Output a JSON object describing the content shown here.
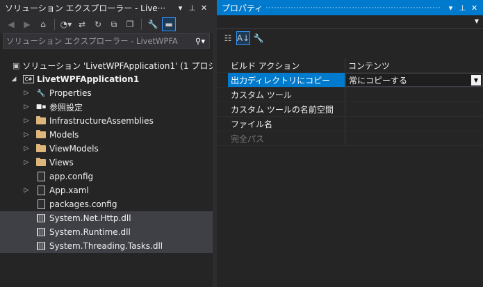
{
  "solution_explorer": {
    "title": "ソリューション エクスプローラー - Live···",
    "search_placeholder": "ソリューション エクスプローラー - LivetWPFA",
    "tree": [
      {
        "label": "ソリューション 'LivetWPFApplication1' (1 プロジ",
        "icon": "solution-icon",
        "expander": "none",
        "indent": 0
      },
      {
        "label": "LivetWPFApplication1",
        "icon": "csharp-project-icon",
        "expander": "expanded",
        "indent": 1,
        "bold": true
      },
      {
        "label": "Properties",
        "icon": "wrench-icon",
        "expander": "collapsed",
        "indent": 2
      },
      {
        "label": "参照設定",
        "icon": "references-icon",
        "expander": "collapsed",
        "indent": 2
      },
      {
        "label": "InfrastructureAssemblies",
        "icon": "folder-icon",
        "expander": "collapsed",
        "indent": 2
      },
      {
        "label": "Models",
        "icon": "folder-icon",
        "expander": "collapsed",
        "indent": 2
      },
      {
        "label": "ViewModels",
        "icon": "folder-icon",
        "expander": "collapsed",
        "indent": 2
      },
      {
        "label": "Views",
        "icon": "folder-icon",
        "expander": "collapsed",
        "indent": 2
      },
      {
        "label": "app.config",
        "icon": "config-file-icon",
        "expander": "none",
        "indent": 2
      },
      {
        "label": "App.xaml",
        "icon": "xaml-file-icon",
        "expander": "collapsed",
        "indent": 2
      },
      {
        "label": "packages.config",
        "icon": "config-file-icon",
        "expander": "none",
        "indent": 2
      },
      {
        "label": "System.Net.Http.dll",
        "icon": "dll-icon",
        "expander": "none",
        "indent": 2,
        "selected": true
      },
      {
        "label": "System.Runtime.dll",
        "icon": "dll-icon",
        "expander": "none",
        "indent": 2,
        "selected": true
      },
      {
        "label": "System.Threading.Tasks.dll",
        "icon": "dll-icon",
        "expander": "none",
        "indent": 2,
        "selected": true
      }
    ]
  },
  "properties": {
    "title": "プロパティ",
    "rows": [
      {
        "name": "ビルド アクション",
        "value": "コンテンツ"
      },
      {
        "name": "出力ディレクトリにコピー",
        "value": "常にコピーする",
        "selected": true
      },
      {
        "name": "カスタム ツール",
        "value": ""
      },
      {
        "name": "カスタム ツールの名前空間",
        "value": ""
      },
      {
        "name": "ファイル名",
        "value": ""
      },
      {
        "name": "完全パス",
        "value": "",
        "disabled": true
      }
    ]
  },
  "colors": {
    "accent": "#007acc",
    "background": "#252526",
    "selection": "#3f3f46"
  }
}
